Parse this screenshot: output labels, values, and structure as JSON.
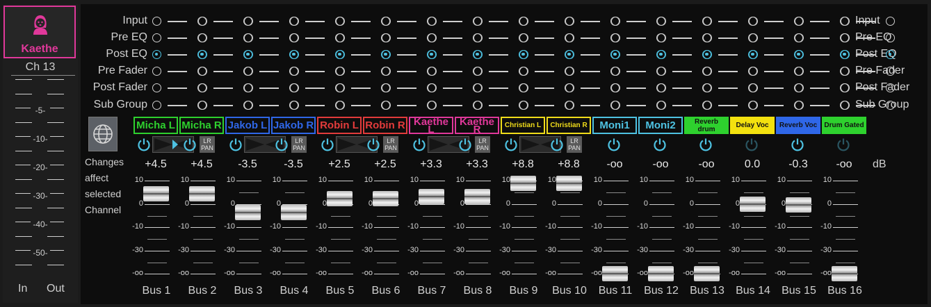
{
  "channel": {
    "name": "Kaethe",
    "number": "Ch 13",
    "meter_scale": [
      "-5-",
      "-10-",
      "-20-",
      "-30-",
      "-40-",
      "-50-"
    ],
    "in_label": "In",
    "out_label": "Out",
    "accent": "#e0389a"
  },
  "taps": {
    "left_labels": [
      "Input",
      "Pre EQ",
      "Post EQ",
      "Pre Fader",
      "Post Fader",
      "Sub Group"
    ],
    "right_labels": [
      "Input",
      "Pre EQ",
      "Post EQ",
      "Pre Fader",
      "Post Fader",
      "Sub Group"
    ],
    "selected_index": 2
  },
  "changes_note": [
    "Changes",
    "affect",
    "selected",
    "Channel"
  ],
  "db_unit": "dB",
  "fader_scale": [
    "10",
    "0",
    "-10",
    "-30",
    "-oo"
  ],
  "buses": [
    {
      "name": "Bus 1",
      "tag": "Micha L",
      "tag_color": "#2ed12e",
      "tag_bg": "transparent",
      "tag_text": "#2ed12e",
      "gain": "+4.5",
      "fader_db": 4.5,
      "power": "on",
      "pan": "stereo"
    },
    {
      "name": "Bus 2",
      "tag": "Micha R",
      "tag_color": "#2ed12e",
      "tag_bg": "transparent",
      "tag_text": "#2ed12e",
      "gain": "+4.5",
      "fader_db": 4.5,
      "power": "on",
      "pan": "stereo"
    },
    {
      "name": "Bus 3",
      "tag": "Jakob L",
      "tag_color": "#2f67e8",
      "tag_bg": "transparent",
      "tag_text": "#2f67e8",
      "gain": "-3.5",
      "fader_db": -3.5,
      "power": "on",
      "pan": "stereo"
    },
    {
      "name": "Bus 4",
      "tag": "Jakob R",
      "tag_color": "#2f67e8",
      "tag_bg": "transparent",
      "tag_text": "#2f67e8",
      "gain": "-3.5",
      "fader_db": -3.5,
      "power": "on",
      "pan": "stereo"
    },
    {
      "name": "Bus 5",
      "tag": "Robin L",
      "tag_color": "#e23b3b",
      "tag_bg": "transparent",
      "tag_text": "#e23b3b",
      "gain": "+2.5",
      "fader_db": 2.5,
      "power": "on",
      "pan": "stereo"
    },
    {
      "name": "Bus 6",
      "tag": "Robin R",
      "tag_color": "#e23b3b",
      "tag_bg": "transparent",
      "tag_text": "#e23b3b",
      "gain": "+2.5",
      "fader_db": 2.5,
      "power": "on",
      "pan": "stereo"
    },
    {
      "name": "Bus 7",
      "tag": "Kaethe L",
      "tag_color": "#e0389a",
      "tag_bg": "transparent",
      "tag_text": "#e0389a",
      "gain": "+3.3",
      "fader_db": 3.3,
      "power": "on",
      "pan": "stereo"
    },
    {
      "name": "Bus 8",
      "tag": "Kaethe R",
      "tag_color": "#e0389a",
      "tag_bg": "transparent",
      "tag_text": "#e0389a",
      "gain": "+3.3",
      "fader_db": 3.3,
      "power": "on",
      "pan": "stereo"
    },
    {
      "name": "Bus 9",
      "tag": "Christian L",
      "tag_color": "#f0dc1a",
      "tag_bg": "transparent",
      "tag_text": "#f0dc1a",
      "gain": "+8.8",
      "fader_db": 8.8,
      "power": "on",
      "pan": "stereo"
    },
    {
      "name": "Bus 10",
      "tag": "Christian R",
      "tag_color": "#f0dc1a",
      "tag_bg": "transparent",
      "tag_text": "#f0dc1a",
      "gain": "+8.8",
      "fader_db": 8.8,
      "power": "on",
      "pan": "stereo"
    },
    {
      "name": "Bus 11",
      "tag": "Moni1",
      "tag_color": "#4ec2e2",
      "tag_bg": "transparent",
      "tag_text": "#4ec2e2",
      "gain": "-oo",
      "fader_db": null,
      "power": "on",
      "pan": "none"
    },
    {
      "name": "Bus 12",
      "tag": "Moni2",
      "tag_color": "#4ec2e2",
      "tag_bg": "transparent",
      "tag_text": "#4ec2e2",
      "gain": "-oo",
      "fader_db": null,
      "power": "on",
      "pan": "none"
    },
    {
      "name": "Bus 13",
      "tag": "Reverb drum",
      "tag_color": "#2ed12e",
      "tag_bg": "#2ed12e",
      "tag_text": "#111111",
      "gain": "-oo",
      "fader_db": null,
      "power": "on",
      "pan": "none"
    },
    {
      "name": "Bus 14",
      "tag": "Delay Voc",
      "tag_color": "#f3e10f",
      "tag_bg": "#f3e10f",
      "tag_text": "#111111",
      "gain": "0.0",
      "fader_db": 0.0,
      "power": "off",
      "pan": "none"
    },
    {
      "name": "Bus 15",
      "tag": "Reverb Voc",
      "tag_color": "#2f67e8",
      "tag_bg": "#2f67e8",
      "tag_text": "#111111",
      "gain": "-0.3",
      "fader_db": -0.3,
      "power": "on",
      "pan": "none"
    },
    {
      "name": "Bus 16",
      "tag": "Drum Gated",
      "tag_color": "#2ed12e",
      "tag_bg": "#2ed12e",
      "tag_text": "#111111",
      "gain": "-oo",
      "fader_db": null,
      "power": "off",
      "pan": "none"
    }
  ],
  "pan_button_label": "LR PAN"
}
